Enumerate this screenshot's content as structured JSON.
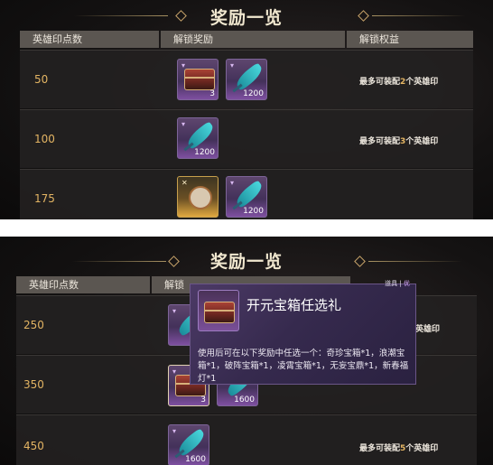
{
  "title": "奖励一览",
  "headers": {
    "points": "英雄印点数",
    "rewards": "解锁奖励",
    "benefits": "解锁权益",
    "rewards_partial": "解锁"
  },
  "panel1": {
    "rows": [
      {
        "points": "50",
        "benefit_prefix": "最多可装配",
        "benefit_count": "2",
        "benefit_suffix": "个英雄印",
        "items": [
          {
            "icon": "treasure-chest-icon",
            "count": "3"
          },
          {
            "icon": "feather-icon",
            "count": "1200"
          }
        ]
      },
      {
        "points": "100",
        "benefit_prefix": "最多可装配",
        "benefit_count": "3",
        "benefit_suffix": "个英雄印",
        "items": [
          {
            "icon": "feather-icon",
            "count": "1200"
          }
        ]
      },
      {
        "points": "175",
        "benefit_prefix": "",
        "benefit_count": "",
        "benefit_suffix": "",
        "items": [
          {
            "icon": "scroll-icon",
            "count": ""
          },
          {
            "icon": "feather-icon",
            "count": "1200"
          }
        ]
      }
    ]
  },
  "panel2": {
    "rows": [
      {
        "points": "250",
        "benefit_partial": "英雄印"
      },
      {
        "points": "350",
        "items": [
          {
            "icon": "treasure-chest-icon",
            "count": "3"
          },
          {
            "icon": "feather-icon",
            "count": "1600"
          }
        ]
      },
      {
        "points": "450",
        "benefit_prefix": "最多可装配",
        "benefit_count": "5",
        "benefit_suffix": "个英雄印",
        "items": [
          {
            "icon": "feather-icon",
            "count": "1600"
          }
        ]
      }
    ]
  },
  "tooltip": {
    "title": "开元宝箱任选礼",
    "tag_type": "道具",
    "tag_sep": "|",
    "tag_quality": "优",
    "description": "使用后可在以下奖励中任选一个：奇珍宝箱*1，浪潮宝箱*1，破阵宝箱*1，凌霄宝箱*1，无妄宝鼎*1，新春福灯*1"
  },
  "colors": {
    "accent_gold": "#e3b463",
    "header_bg": "#5b5651",
    "tooltip_bg": "#3e3058"
  }
}
